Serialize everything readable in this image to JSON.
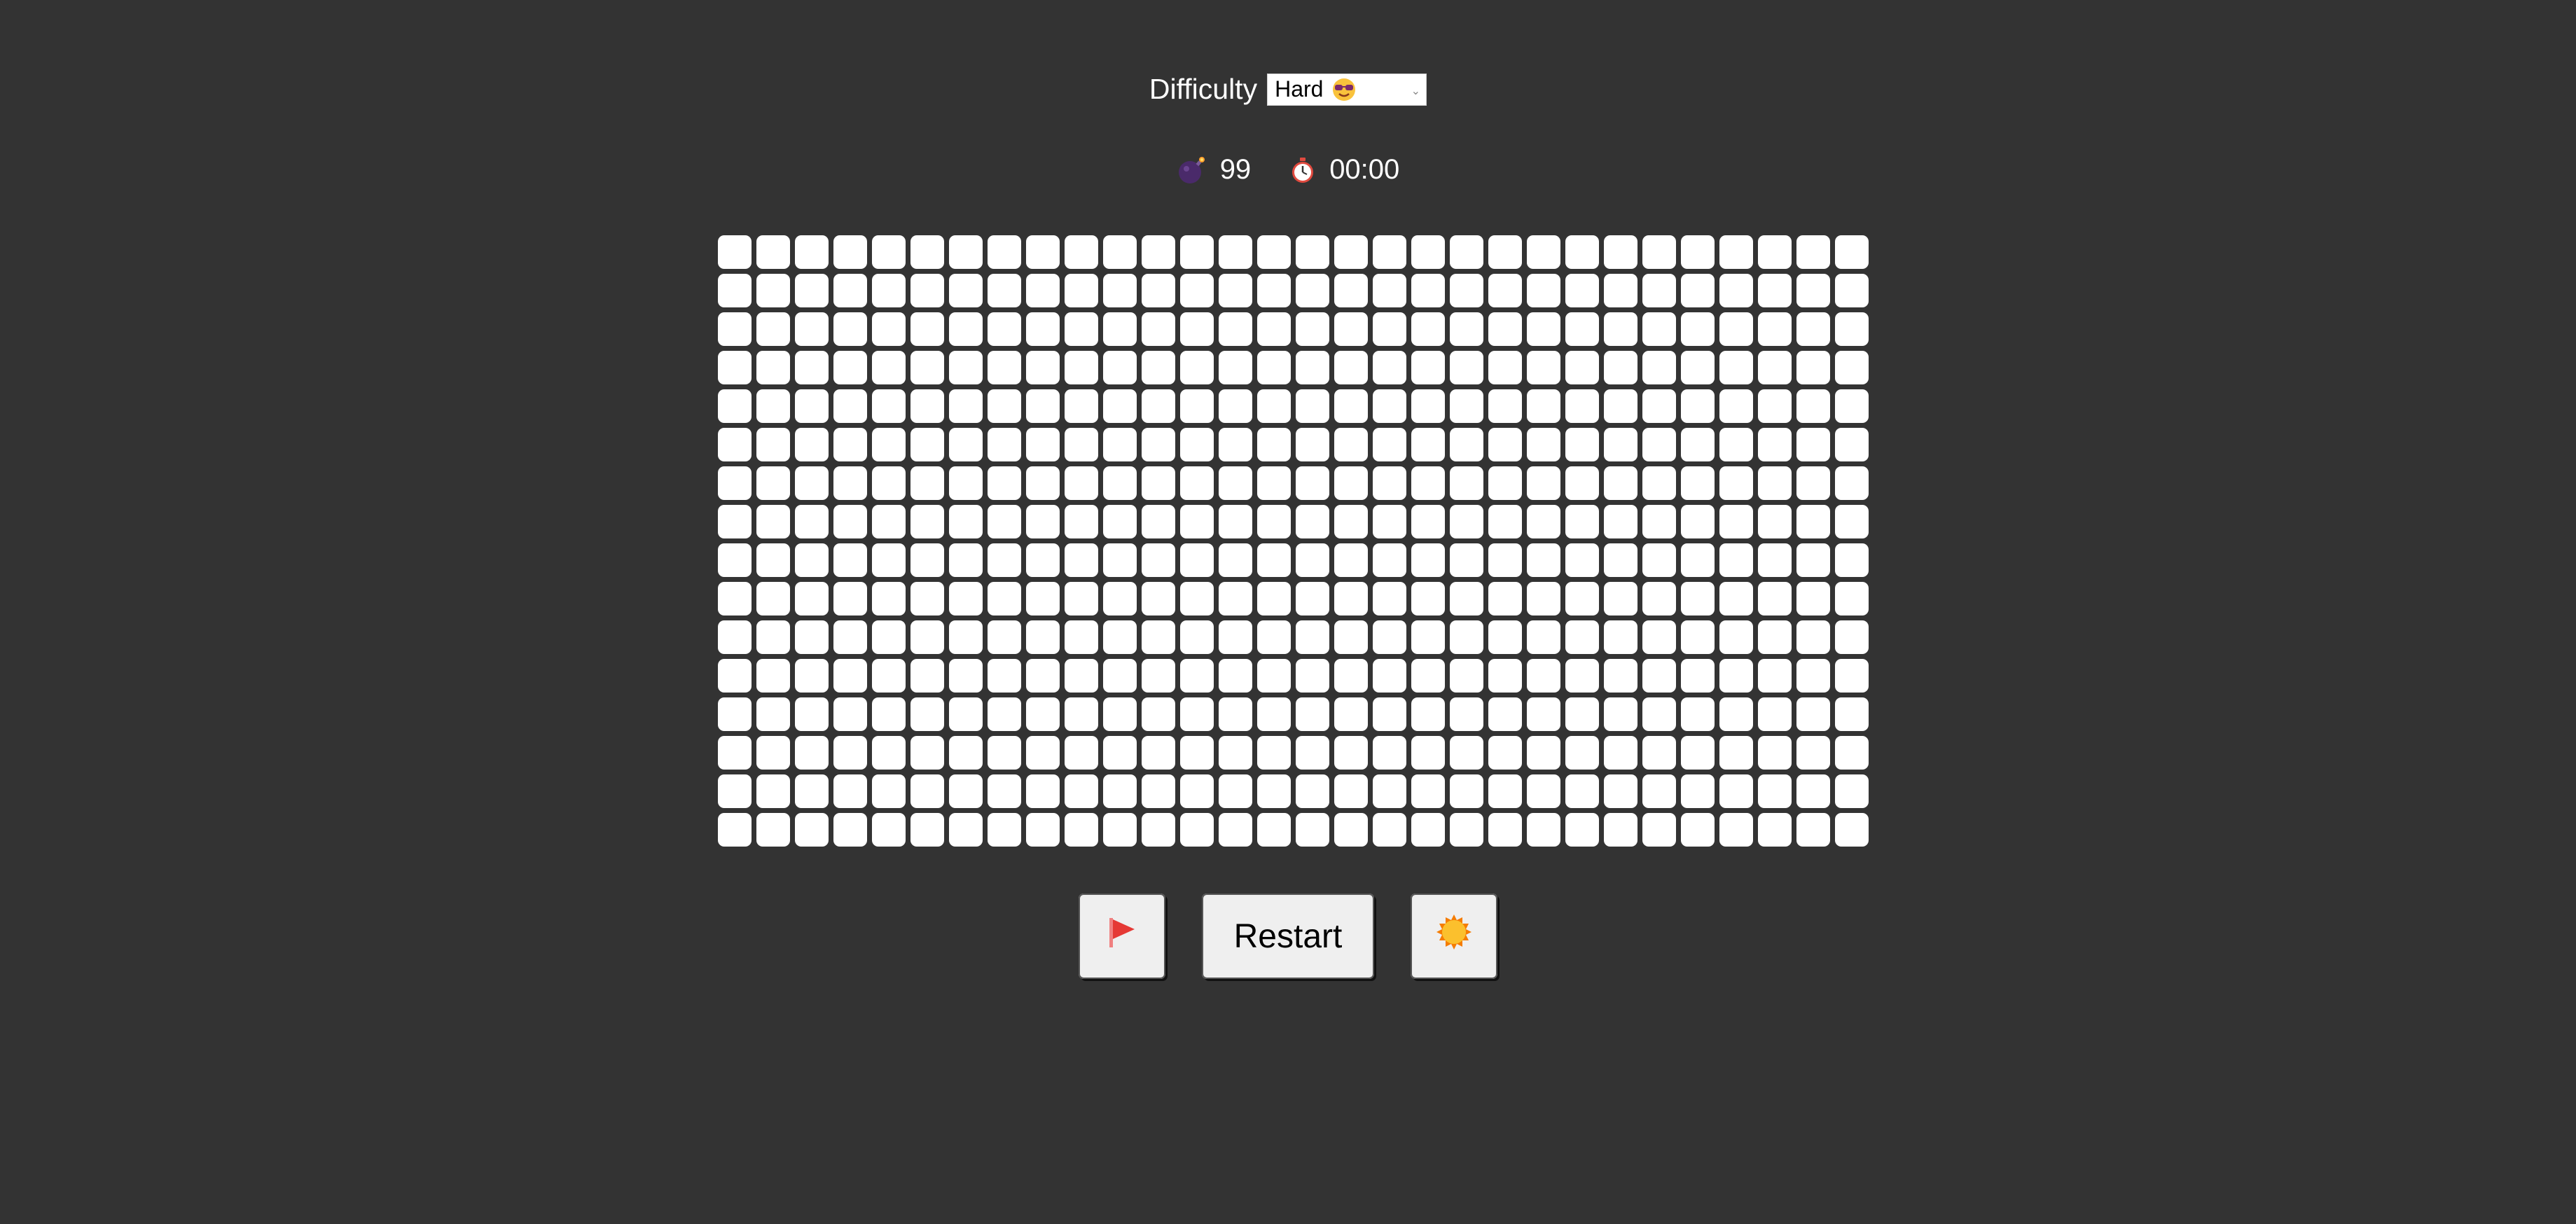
{
  "difficulty": {
    "label": "Difficulty",
    "selected": "Hard"
  },
  "stats": {
    "mines": "99",
    "timer": "00:00"
  },
  "board": {
    "rows": 16,
    "columns": 30
  },
  "controls": {
    "restart_label": "Restart"
  },
  "icons": {
    "difficulty_emoji": "sunglasses-face-icon",
    "mines": "bomb-icon",
    "timer": "stopwatch-icon",
    "flag": "flag-icon",
    "theme": "sun-icon"
  },
  "colors": {
    "background": "#333333",
    "cell": "#ffffff",
    "button": "#efefef",
    "flag": "#e53935",
    "sun": "#fbc02d"
  }
}
